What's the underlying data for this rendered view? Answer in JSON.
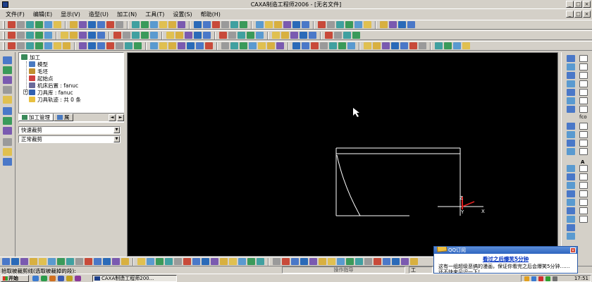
{
  "window": {
    "title": "CAXA制造工程师2006 - [无名文件]",
    "controls": [
      "_",
      "□",
      "×"
    ]
  },
  "menu": [
    "文件(F)",
    "编辑(E)",
    "显示(V)",
    "造型(U)",
    "加工(N)",
    "工具(T)",
    "设置(S)",
    "帮助(H)"
  ],
  "tree": {
    "root": "加工",
    "children": [
      "模型",
      "毛坯",
      "起始点",
      "机床后置 : fanuc",
      "刀具库 : fanuc",
      "刀具轨迹 : 共 0 条"
    ]
  },
  "panel_tabs": {
    "tab1": "加工管理",
    "tab2": "属"
  },
  "combos": {
    "first": "快速裁剪",
    "second": "正常裁剪"
  },
  "axis_labels": {
    "x": "X",
    "y": "Y",
    "z": "Z"
  },
  "status": {
    "prompt": "拾取被裁剪线(选取被裁掉的段):",
    "middle": "操作指导",
    "right": "工"
  },
  "taskbar": {
    "start": "开始",
    "task": "CAXA制造工程师200...",
    "clock": "17:51"
  },
  "qq_popup": {
    "header": "QQ订阅",
    "close": "×",
    "title": "看过之后爆笑5分钟",
    "body": "这有一组超级恶搞的漫画，保证你看完之后会爆笑5分钟……还不快来见识一下！"
  },
  "right_tool_labels": {
    "text_tool": "A",
    "f_tool": "fco"
  },
  "colors": {
    "canvas": "#000000",
    "geometry": "#ffffff",
    "axis_red": "#e02020",
    "window_face": "#d4d0c8",
    "qq_blue": "#2d64c0"
  }
}
